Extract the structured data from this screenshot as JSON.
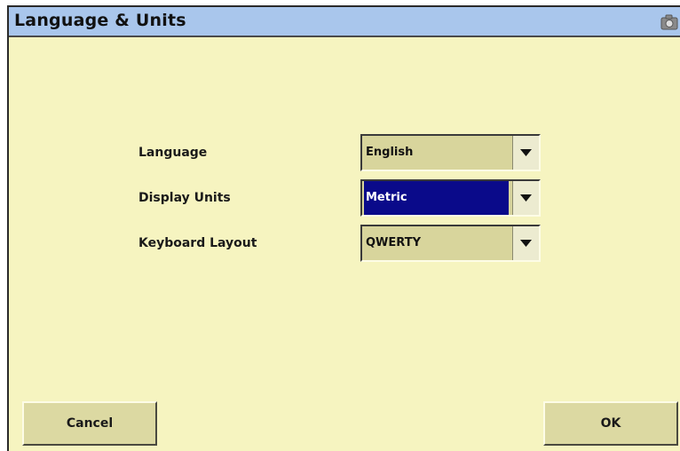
{
  "window": {
    "title": "Language & Units",
    "title_icon": "camera-icon"
  },
  "form": {
    "fields": [
      {
        "label": "Language",
        "value": "English",
        "selected": false
      },
      {
        "label": "Display Units",
        "value": "Metric",
        "selected": true
      },
      {
        "label": "Keyboard Layout",
        "value": "QWERTY",
        "selected": false
      }
    ]
  },
  "buttons": {
    "cancel_label": "Cancel",
    "ok_label": "OK"
  },
  "colors": {
    "background": "#f6f4c0",
    "titlebar": "#a9c6ec",
    "selection": "#0a0a8a",
    "button": "#dcd9a2"
  }
}
